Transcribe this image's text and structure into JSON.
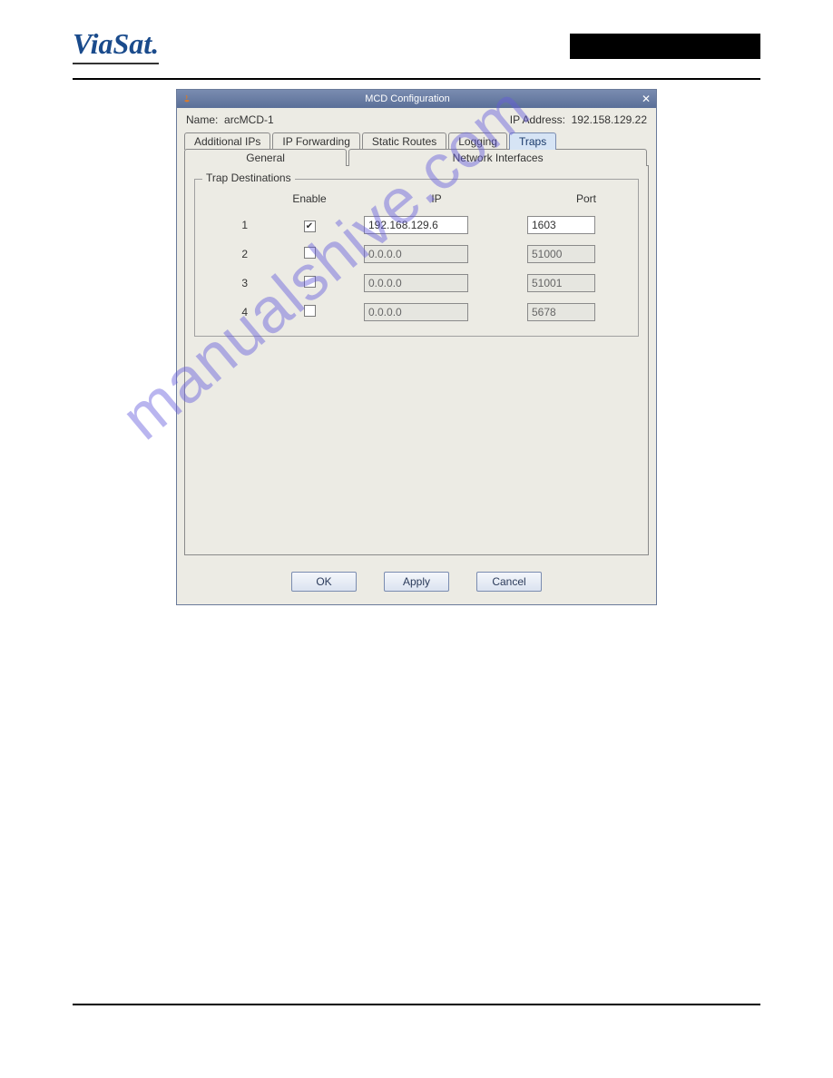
{
  "header": {
    "logo_text": "ViaSat"
  },
  "dialog": {
    "title": "MCD Configuration",
    "name_label": "Name:",
    "name_value": "arcMCD-1",
    "ip_label": "IP Address:",
    "ip_value": "192.158.129.22",
    "tabs_row1": {
      "additional_ips": "Additional IPs",
      "ip_forwarding": "IP Forwarding",
      "static_routes": "Static Routes",
      "logging": "Logging",
      "traps": "Traps"
    },
    "tabs_row2": {
      "general": "General",
      "network_interfaces": "Network Interfaces"
    },
    "fieldset_legend": "Trap Destinations",
    "columns": {
      "enable": "Enable",
      "ip": "IP",
      "port": "Port"
    },
    "rows": [
      {
        "num": "1",
        "checked": true,
        "ip": "192.168.129.6",
        "port": "1603",
        "enabled": true
      },
      {
        "num": "2",
        "checked": false,
        "ip": "0.0.0.0",
        "port": "51000",
        "enabled": false
      },
      {
        "num": "3",
        "checked": false,
        "ip": "0.0.0.0",
        "port": "51001",
        "enabled": false
      },
      {
        "num": "4",
        "checked": false,
        "ip": "0.0.0.0",
        "port": "5678",
        "enabled": false
      }
    ],
    "buttons": {
      "ok": "OK",
      "apply": "Apply",
      "cancel": "Cancel"
    }
  },
  "watermark": "manualshive.com"
}
